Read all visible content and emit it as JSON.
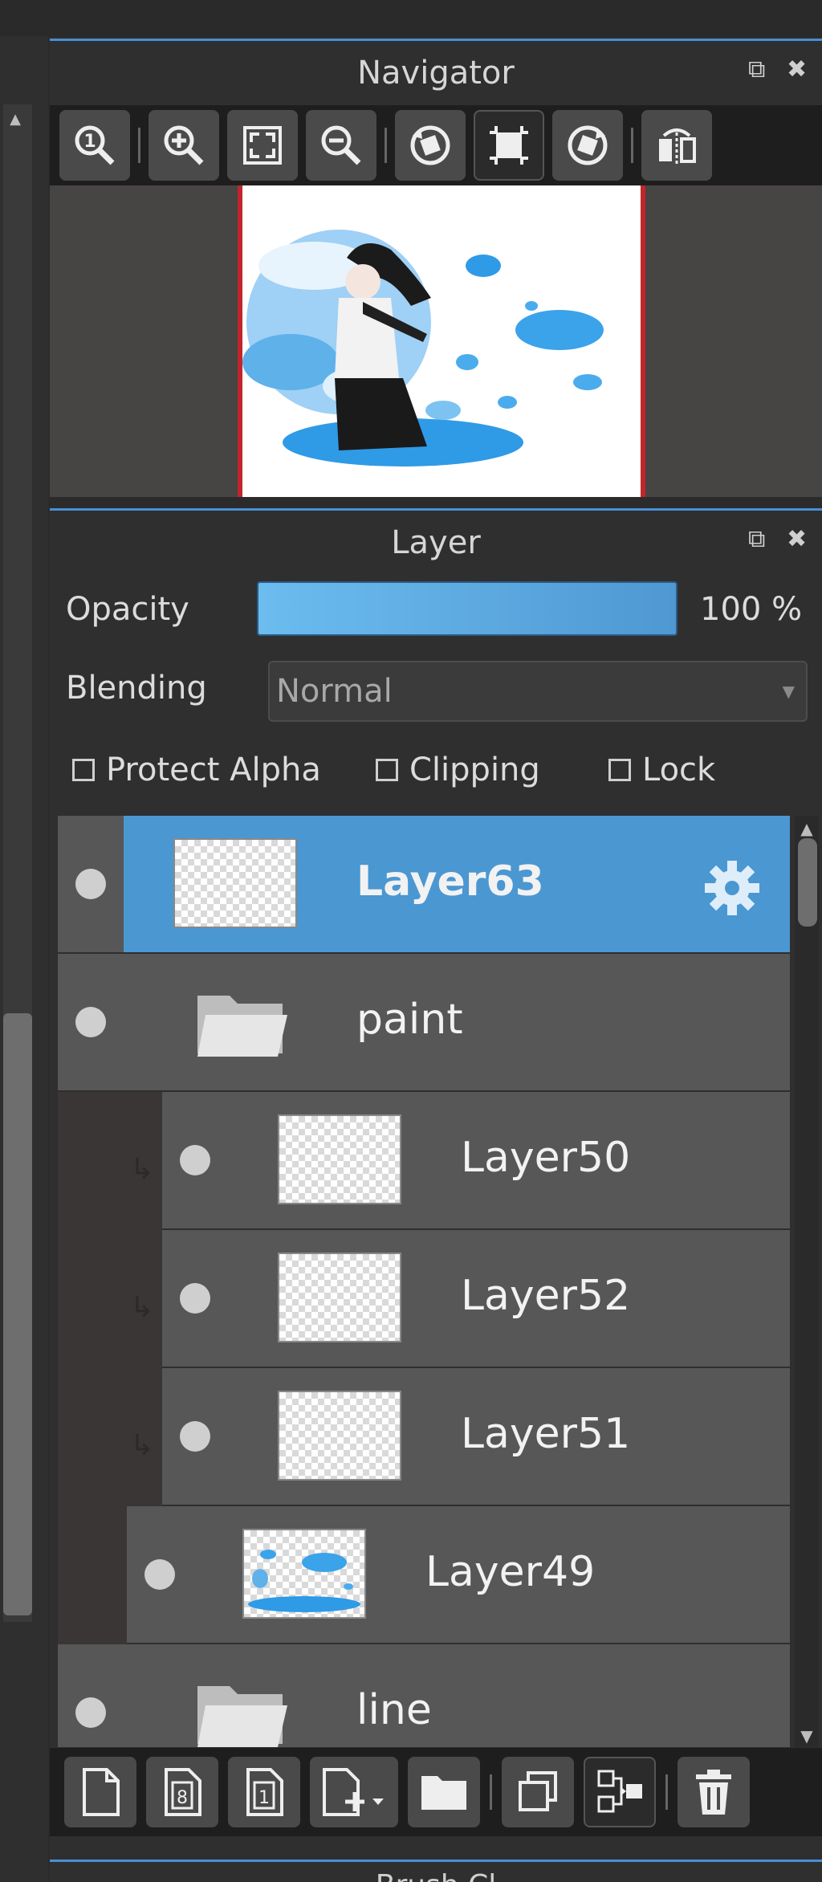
{
  "navigator": {
    "title": "Navigator",
    "controls": {
      "float": "⧉",
      "close": "✖"
    },
    "toolbar": [
      "zoom-actual-icon",
      "zoom-in-icon",
      "fit-screen-icon",
      "zoom-out-icon",
      "rotate-left-icon",
      "fit-canvas-icon",
      "rotate-right-icon",
      "flip-horizontal-icon"
    ]
  },
  "layer": {
    "title": "Layer",
    "controls": {
      "float": "⧉",
      "close": "✖"
    },
    "opacity_label": "Opacity",
    "opacity_value": "100 %",
    "opacity_level": 1.0,
    "blending_label": "Blending",
    "blending_value": "Normal",
    "checks": {
      "protect_alpha": "Protect Alpha",
      "clipping": "Clipping",
      "lock": "Lock"
    },
    "rows": [
      {
        "name": "Layer63",
        "kind": "layer",
        "selected": true
      },
      {
        "name": "paint",
        "kind": "folder"
      },
      {
        "name": "Layer50",
        "kind": "layer",
        "clipped": true
      },
      {
        "name": "Layer52",
        "kind": "layer",
        "clipped": true
      },
      {
        "name": "Layer51",
        "kind": "layer",
        "clipped": true
      },
      {
        "name": "Layer49",
        "kind": "layer"
      },
      {
        "name": "line",
        "kind": "folder"
      }
    ],
    "toolbar": [
      "new-layer-icon",
      "new-8bit-layer-icon",
      "new-1bit-layer-icon",
      "add-layer-menu-icon",
      "new-folder-icon",
      "duplicate-layer-icon",
      "merge-down-icon",
      "delete-layer-icon"
    ]
  },
  "brush_panel": {
    "title": "Brush Cl"
  },
  "colors": {
    "accent": "#4a97d2",
    "panel_bg": "#2f2f2f",
    "row_bg": "#575757",
    "frame_red": "#c0262b"
  }
}
